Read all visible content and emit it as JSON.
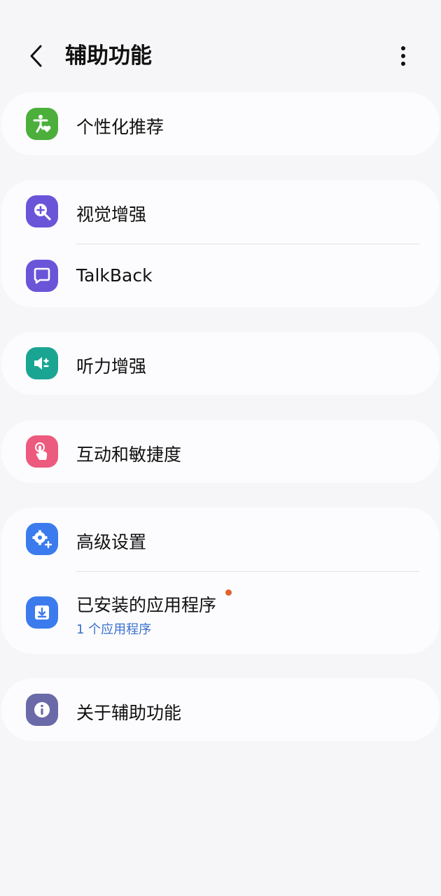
{
  "header": {
    "title": "辅助功能",
    "back_icon": "chevron-left-icon",
    "more_icon": "more-vertical-icon"
  },
  "items": {
    "personalized": {
      "label": "个性化推荐",
      "icon": "accessibility-person-heart-icon",
      "icon_color": "#4caf3c"
    },
    "vision": {
      "label": "视觉增强",
      "icon": "zoom-in-icon",
      "icon_color": "#6a55d9"
    },
    "talkback": {
      "label": "TalkBack",
      "icon": "chat-bubble-icon",
      "icon_color": "#6a55d9"
    },
    "hearing": {
      "label": "听力增强",
      "icon": "volume-adjust-icon",
      "icon_color": "#1aa592"
    },
    "interaction": {
      "label": "互动和敏捷度",
      "icon": "touch-hand-icon",
      "icon_color": "#ec5a7d"
    },
    "advanced": {
      "label": "高级设置",
      "icon": "gear-plus-icon",
      "icon_color": "#3b7bed"
    },
    "installed": {
      "label": "已安装的应用程序",
      "sublabel": "1 个应用程序",
      "icon": "download-box-icon",
      "icon_color": "#3b7bed",
      "has_new_badge": true,
      "badge_color": "#e0632b"
    },
    "about": {
      "label": "关于辅助功能",
      "icon": "info-icon",
      "icon_color": "#6a6aa8"
    }
  }
}
